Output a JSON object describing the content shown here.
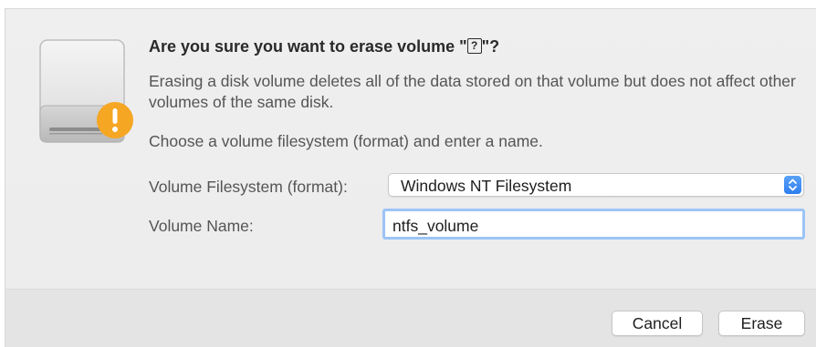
{
  "dialog": {
    "title_prefix": "Are you sure you want to erase volume \"",
    "title_placeholder": "?",
    "title_suffix": "\"?",
    "description": "Erasing a disk volume deletes all of the data stored on that volume but does not affect other volumes of the same disk.",
    "instruction": "Choose a volume filesystem (format) and enter a name.",
    "filesystem_label": "Volume Filesystem (format):",
    "filesystem_value": "Windows NT Filesystem",
    "name_label": "Volume Name:",
    "name_value": "ntfs_volume",
    "cancel_label": "Cancel",
    "erase_label": "Erase"
  },
  "icons": {
    "disk": "external-disk-icon",
    "warning": "warning-badge-icon",
    "select_arrows": "chevron-up-down-icon"
  },
  "colors": {
    "warning_badge": "#f5a623",
    "focus_ring": "#9cc4f6",
    "select_accent": "#3b86f2"
  }
}
